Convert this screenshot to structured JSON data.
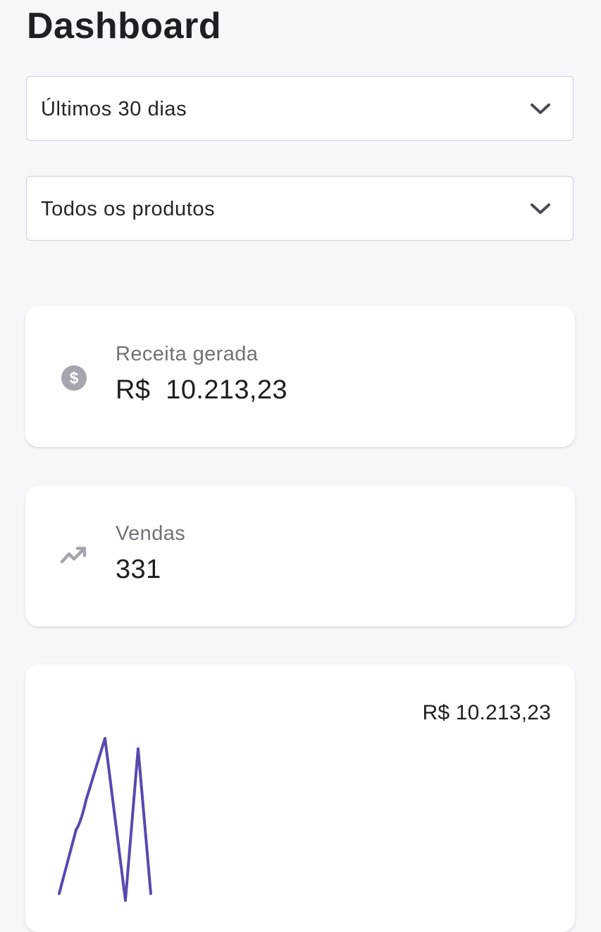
{
  "header": {
    "title": "Dashboard"
  },
  "filters": {
    "period": {
      "selected": "Últimos 30 dias"
    },
    "product": {
      "selected": "Todos os produtos"
    }
  },
  "stats": {
    "revenue": {
      "icon": "dollar-circle-icon",
      "label": "Receita gerada",
      "value": "R$  10.213,23"
    },
    "sales": {
      "icon": "trending-up-icon",
      "label": "Vendas",
      "value": "331"
    }
  },
  "revenue_chart": {
    "total_label": "R$ 10.213,23"
  },
  "colors": {
    "background": "#f6f6fb",
    "card": "#ffffff",
    "icon_gray": "#a3a6ae",
    "chart_line": "#5a48b0"
  },
  "chart_data": {
    "type": "line",
    "title": "",
    "xlabel": "",
    "ylabel": "",
    "ylim": [
      0,
      100
    ],
    "grid": false,
    "legend": "none",
    "series": [
      {
        "values": [
          8,
          45,
          62,
          98,
          4,
          92,
          8
        ]
      }
    ]
  }
}
